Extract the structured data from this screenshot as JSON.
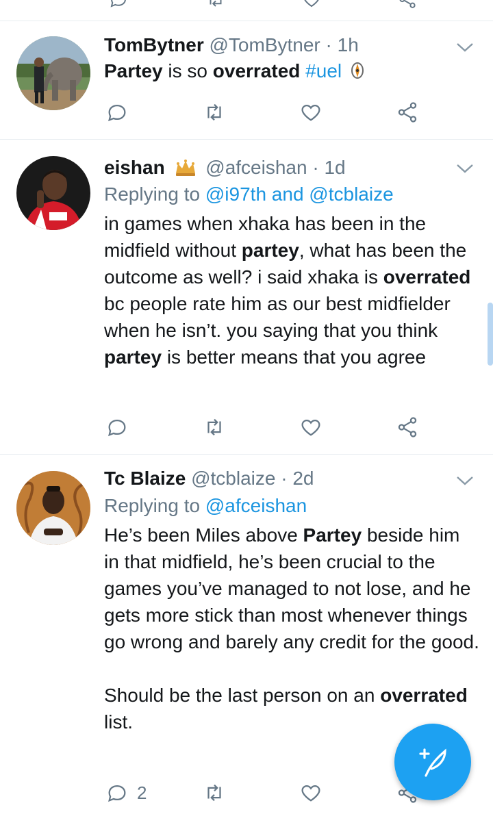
{
  "tweets": [
    {
      "name": "TomBytner",
      "handle": "@TomBytner",
      "sep": " · ",
      "time": "1h",
      "body": [
        {
          "t": "Partey",
          "b": true
        },
        {
          "t": " is so ",
          "b": false
        },
        {
          "t": "overrated",
          "b": true
        },
        {
          "t": " ",
          "b": false
        },
        {
          "t": "#uel",
          "link": true
        }
      ],
      "reply_count": ""
    },
    {
      "name": "eishan",
      "handle": "@afceishan",
      "sep": " · ",
      "time": "1d",
      "replying_prefix": "Replying to ",
      "replying_to": "@i97th and @tcblaize",
      "body": [
        {
          "t": "in games when xhaka has been in the midfield without ",
          "b": false
        },
        {
          "t": "partey",
          "b": true
        },
        {
          "t": ", what has been the outcome as well? i said xhaka is ",
          "b": false
        },
        {
          "t": "overrated",
          "b": true
        },
        {
          "t": " bc people rate him as our best midfielder when he isn’t. you saying that you think ",
          "b": false
        },
        {
          "t": "partey",
          "b": true
        },
        {
          "t": " is better means that you agree",
          "b": false
        }
      ],
      "reply_count": ""
    },
    {
      "name": "Tc Blaize",
      "handle": "@tcblaize",
      "sep": " · ",
      "time": "2d",
      "replying_prefix": "Replying to ",
      "replying_to": "@afceishan",
      "body": [
        {
          "t": "He’s been Miles above ",
          "b": false
        },
        {
          "t": "Partey",
          "b": true
        },
        {
          "t": " beside him in that midfield, he’s been crucial to the games you’ve managed to not lose, and he gets more stick than most whenever things go wrong and barely any credit for the good.",
          "b": false
        },
        {
          "br": 2
        },
        {
          "t": "Should be the last person on an ",
          "b": false
        },
        {
          "t": "overrated",
          "b": true
        },
        {
          "t": " list.",
          "b": false
        }
      ],
      "reply_count": "2"
    }
  ],
  "icons": {
    "reply": "reply-icon",
    "retweet": "retweet-icon",
    "like": "like-icon",
    "share": "share-icon",
    "more": "chevron-down-icon",
    "compose": "compose-tweet-icon"
  },
  "colors": {
    "link": "#1b95e0",
    "muted": "#657786",
    "fab": "#1da1f2"
  }
}
